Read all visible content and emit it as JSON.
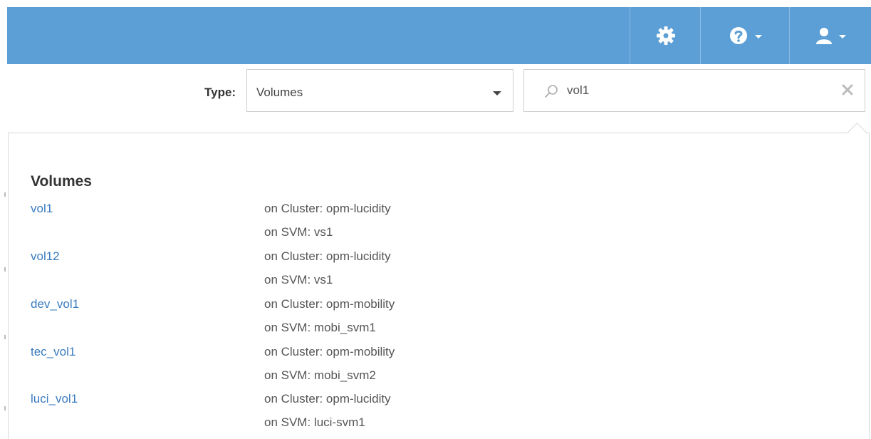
{
  "header": {
    "colors": {
      "bar": "#5c9fd6",
      "link": "#3a7cc0"
    },
    "buttons": [
      {
        "icon": "gear-icon"
      },
      {
        "icon": "help-icon"
      },
      {
        "icon": "user-icon"
      }
    ]
  },
  "filter": {
    "type_label": "Type:",
    "type_value": "Volumes",
    "search_value": "vol1"
  },
  "results": {
    "section_title": "Volumes",
    "items": [
      {
        "name": "vol1",
        "cluster": "on Cluster: opm-lucidity",
        "svm": "on SVM: vs1"
      },
      {
        "name": "vol12",
        "cluster": "on Cluster: opm-lucidity",
        "svm": "on SVM: vs1"
      },
      {
        "name": "dev_vol1",
        "cluster": "on Cluster: opm-mobility",
        "svm": "on SVM: mobi_svm1"
      },
      {
        "name": "tec_vol1",
        "cluster": "on Cluster: opm-mobility",
        "svm": "on SVM: mobi_svm2"
      },
      {
        "name": "luci_vol1",
        "cluster": "on Cluster: opm-lucidity",
        "svm": "on SVM: luci-svm1"
      }
    ]
  }
}
